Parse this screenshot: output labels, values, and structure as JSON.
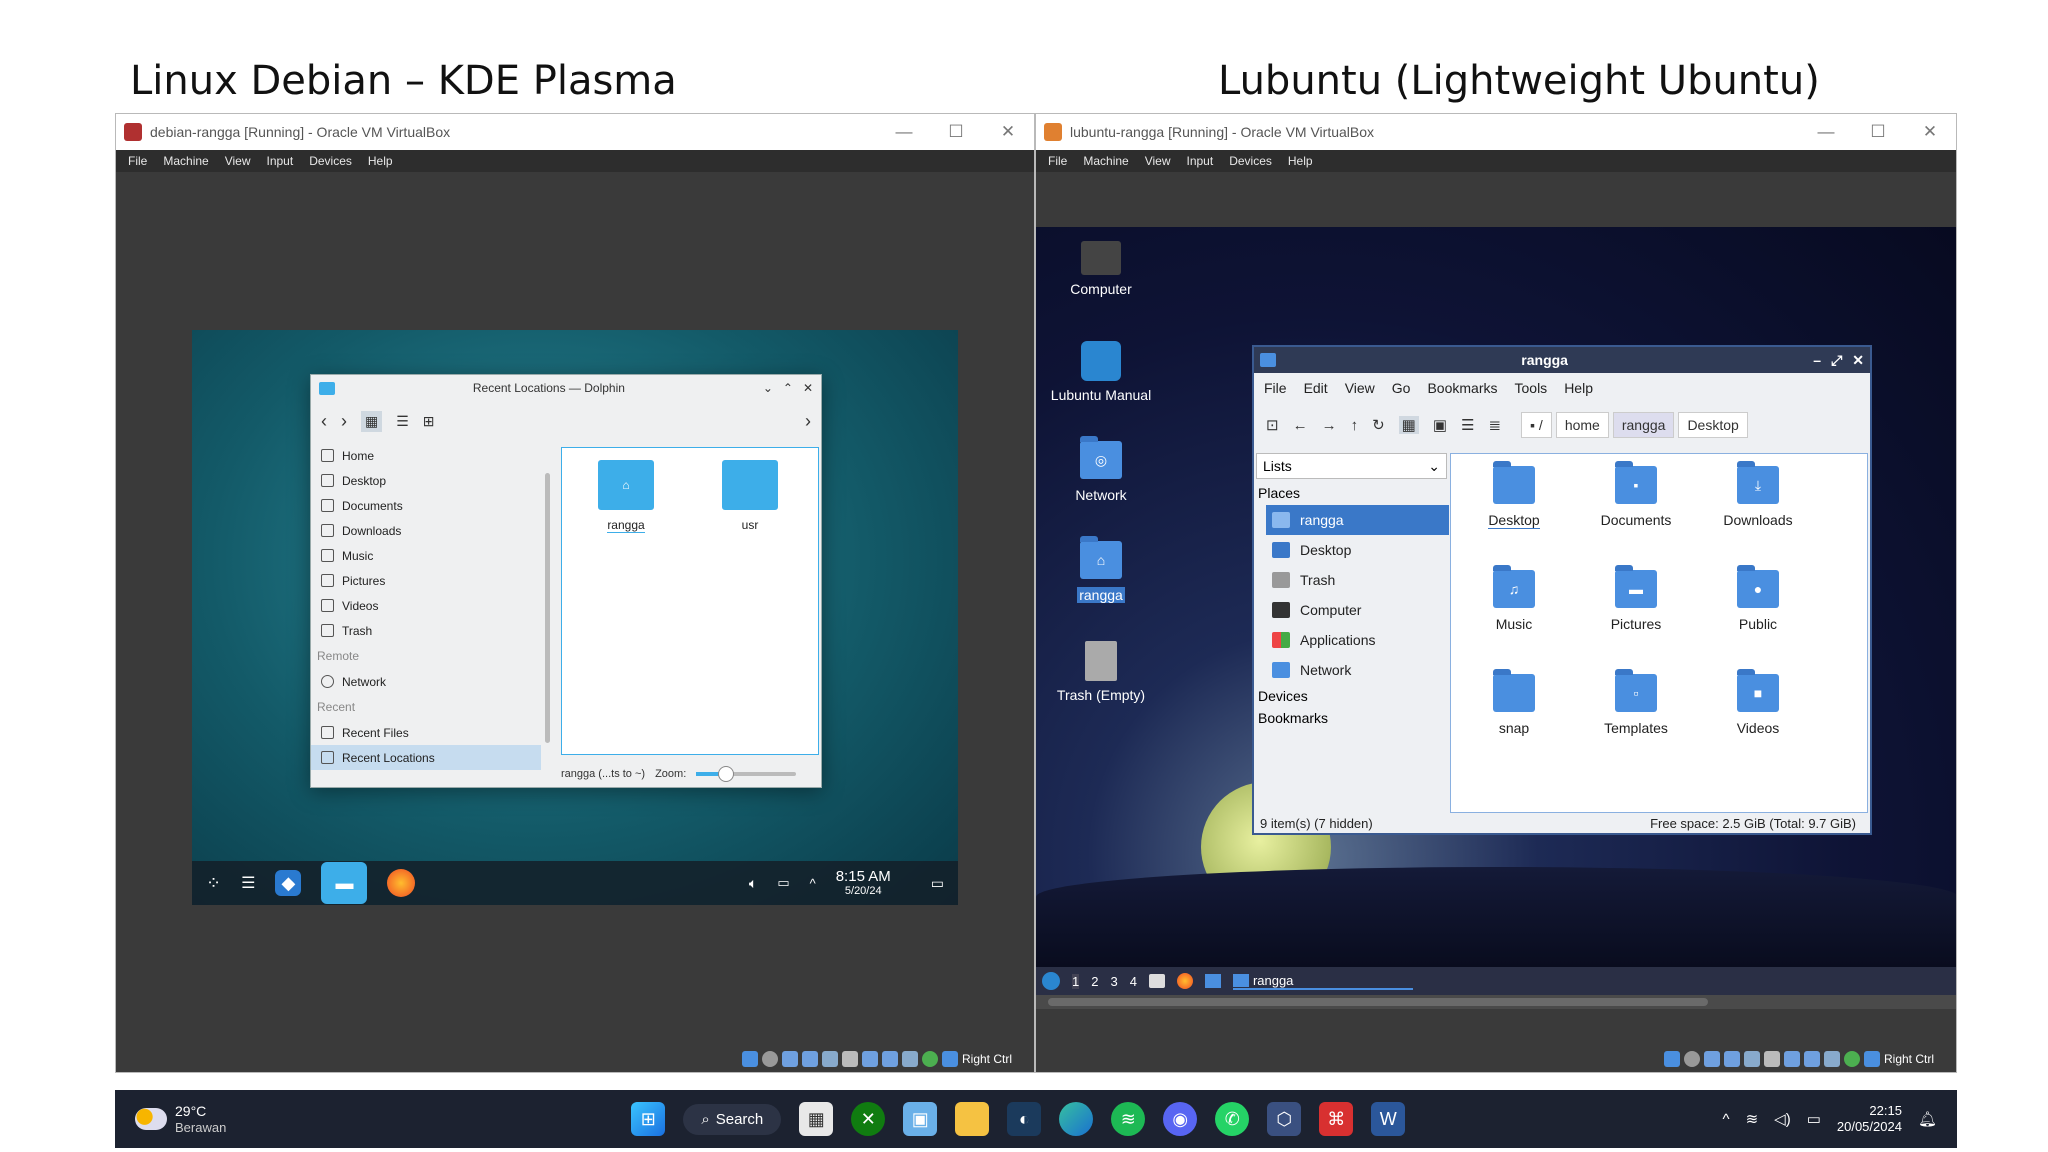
{
  "headings": {
    "left": "Linux Debian – KDE Plasma",
    "right": "Lubuntu (Lightweight Ubuntu)"
  },
  "vbox_menu": [
    "File",
    "Machine",
    "View",
    "Input",
    "Devices",
    "Help"
  ],
  "right_ctrl": "Right Ctrl",
  "debian": {
    "window_title": "debian-rangga [Running] - Oracle VM VirtualBox",
    "dolphin": {
      "title": "Recent Locations — Dolphin",
      "places": [
        "Home",
        "Desktop",
        "Documents",
        "Downloads",
        "Music",
        "Pictures",
        "Videos",
        "Trash"
      ],
      "remote_header": "Remote",
      "remote": [
        "Network"
      ],
      "recent_header": "Recent",
      "recent": [
        "Recent Files",
        "Recent Locations"
      ],
      "files": [
        "rangga",
        "usr"
      ],
      "status": "rangga (...ts to ~)",
      "zoom_label": "Zoom:"
    },
    "panel": {
      "time": "8:15 AM",
      "date": "5/20/24"
    }
  },
  "lubuntu": {
    "window_title": "lubuntu-rangga [Running] - Oracle VM VirtualBox",
    "desktop_icons": [
      "Computer",
      "Lubuntu Manual",
      "Network",
      "rangga",
      "Trash (Empty)"
    ],
    "pcmanfm": {
      "title": "rangga",
      "menu": [
        "File",
        "Edit",
        "View",
        "Go",
        "Bookmarks",
        "Tools",
        "Help"
      ],
      "path": [
        "/",
        "home",
        "rangga",
        "Desktop"
      ],
      "side_dropdown": "Lists",
      "places_header": "Places",
      "places": [
        "rangga",
        "Desktop",
        "Trash",
        "Computer",
        "Applications",
        "Network"
      ],
      "devices_header": "Devices",
      "bookmarks_header": "Bookmarks",
      "files": [
        "Desktop",
        "Documents",
        "Downloads",
        "Music",
        "Pictures",
        "Public",
        "snap",
        "Templates",
        "Videos"
      ],
      "status_left": "9 item(s) (7 hidden)",
      "status_right": "Free space: 2.5 GiB (Total: 9.7 GiB)"
    },
    "panel": {
      "workspaces": [
        "1",
        "2",
        "3",
        "4"
      ],
      "task": "rangga"
    }
  },
  "windows_taskbar": {
    "weather_temp": "29°C",
    "weather_desc": "Berawan",
    "search": "Search",
    "time": "22:15",
    "date": "20/05/2024"
  }
}
